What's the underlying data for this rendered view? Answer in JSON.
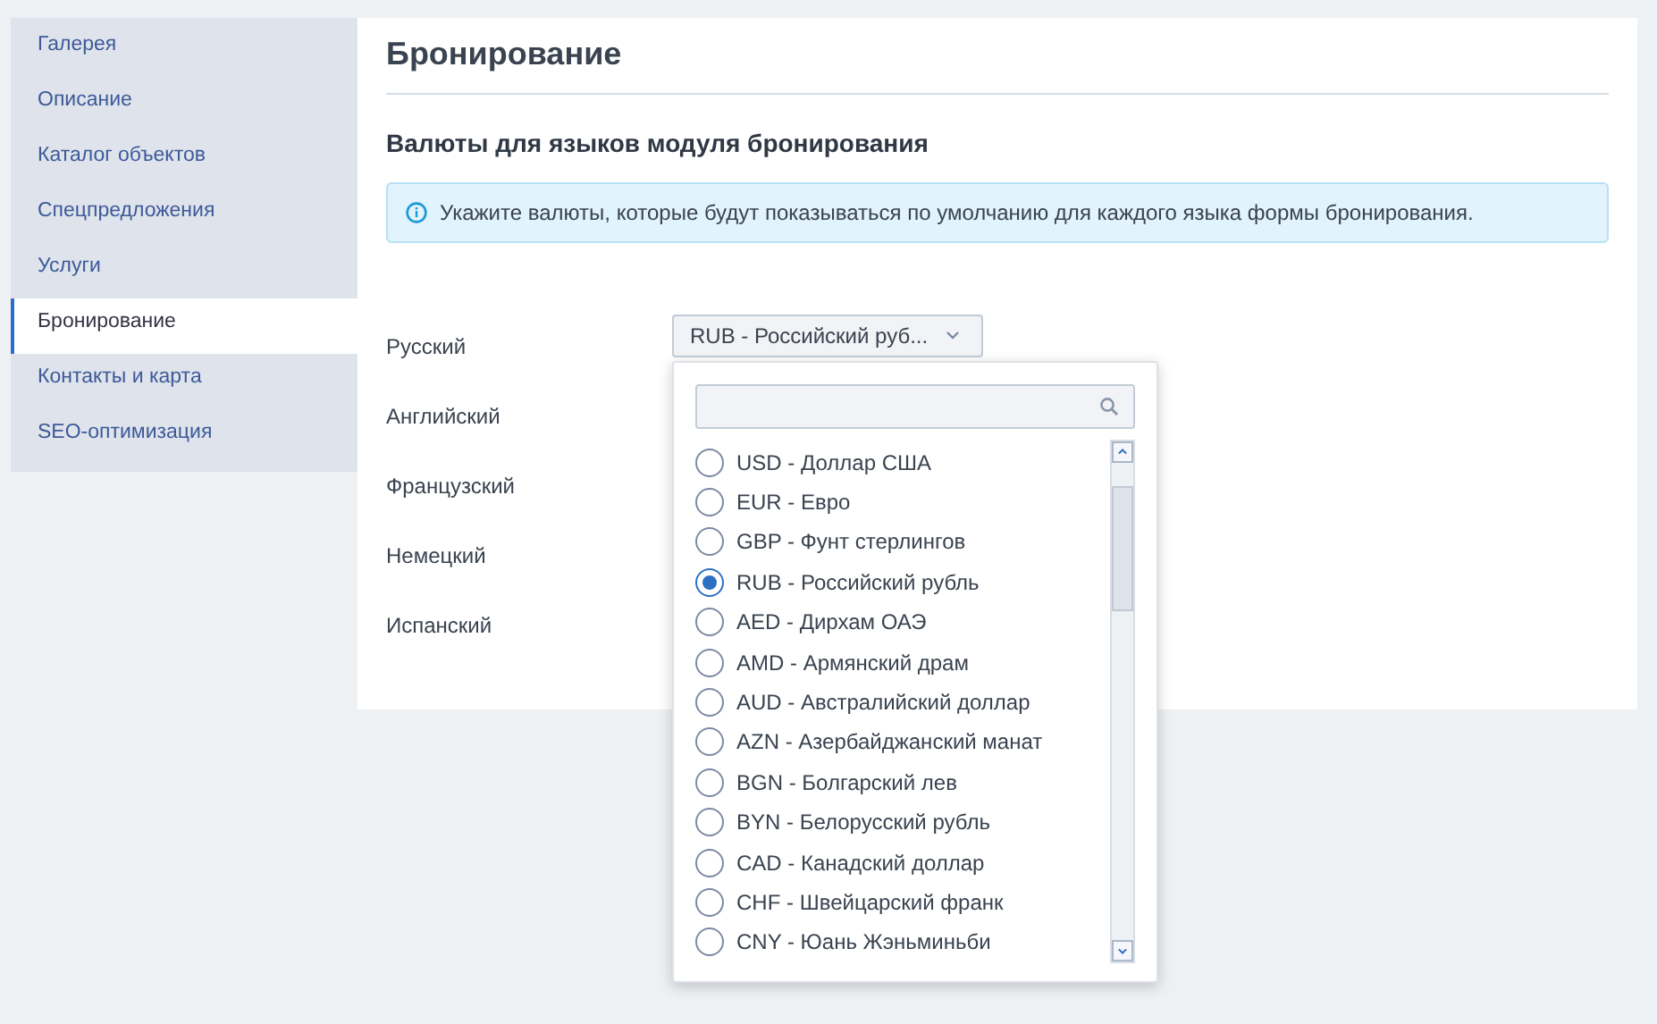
{
  "sidebar": {
    "items": [
      {
        "label": "Галерея",
        "selected": false
      },
      {
        "label": "Описание",
        "selected": false
      },
      {
        "label": "Каталог объектов",
        "selected": false
      },
      {
        "label": "Спецпредложения",
        "selected": false
      },
      {
        "label": "Услуги",
        "selected": false
      },
      {
        "label": "Бронирование",
        "selected": true
      },
      {
        "label": "Контакты и карта",
        "selected": false
      },
      {
        "label": "SEO-оптимизация",
        "selected": false
      }
    ]
  },
  "main": {
    "title": "Бронирование",
    "section_title": "Валюты для языков модуля бронирования",
    "info": "Укажите валюты, которые будут показываться по умолчанию для каждого языка формы бронирования.",
    "languages": [
      {
        "label": "Русский",
        "value": "RUB - Российский руб..."
      },
      {
        "label": "Английский"
      },
      {
        "label": "Французский"
      },
      {
        "label": "Немецкий"
      },
      {
        "label": "Испанский"
      }
    ]
  },
  "dropdown": {
    "expanded": true,
    "options": [
      {
        "label": "USD - Доллар США",
        "selected": false
      },
      {
        "label": "EUR - Евро",
        "selected": false
      },
      {
        "label": "GBP - Фунт стерлингов",
        "selected": false
      },
      {
        "label": "RUB - Российский рубль",
        "selected": true
      },
      {
        "label": "AED - Дирхам ОАЭ",
        "selected": false
      },
      {
        "label": "AMD - Армянский драм",
        "selected": false
      },
      {
        "label": "AUD - Австралийский доллар",
        "selected": false
      },
      {
        "label": "AZN - Азербайджанский манат",
        "selected": false
      },
      {
        "label": "BGN - Болгарский лев",
        "selected": false
      },
      {
        "label": "BYN - Белорусский рубль",
        "selected": false
      },
      {
        "label": "CAD - Канадский доллар",
        "selected": false
      },
      {
        "label": "CHF - Швейцарский франк",
        "selected": false
      },
      {
        "label": "CNY - Юань Жэньминьби",
        "selected": false
      }
    ]
  }
}
